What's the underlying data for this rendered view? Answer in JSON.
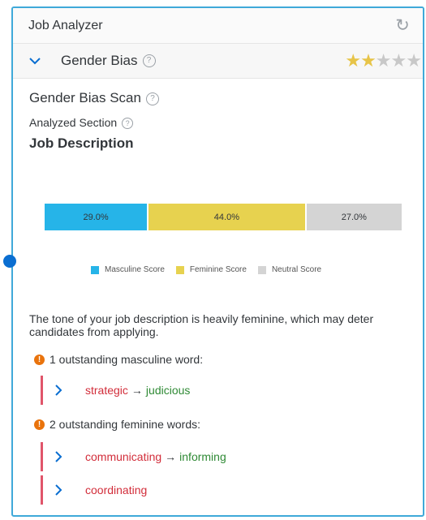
{
  "window": {
    "title": "Job Analyzer"
  },
  "section": {
    "label": "Gender Bias",
    "rating": 2,
    "max_rating": 5
  },
  "scan": {
    "title": "Gender Bias Scan",
    "analyzed_label": "Analyzed Section",
    "analyzed_value": "Job Description"
  },
  "chart_data": {
    "type": "bar",
    "categories": [
      "Masculine Score",
      "Feminine Score",
      "Neutral Score"
    ],
    "values": [
      29.0,
      44.0,
      27.0
    ],
    "value_labels": [
      "29.0%",
      "44.0%",
      "27.0%"
    ],
    "colors": [
      "#26b4e8",
      "#e7d24f",
      "#d4d4d4"
    ],
    "legend": "bottom"
  },
  "tone_text": "The tone of your job description is heavily feminine, which may deter candidates from applying.",
  "masculine": {
    "header": "1 outstanding masculine word:",
    "words": [
      {
        "word": "strategic",
        "suggestion": "judicious"
      }
    ]
  },
  "feminine": {
    "header": "2 outstanding feminine words:",
    "words": [
      {
        "word": "communicating",
        "suggestion": "informing"
      },
      {
        "word": "coordinating",
        "suggestion": ""
      }
    ]
  }
}
